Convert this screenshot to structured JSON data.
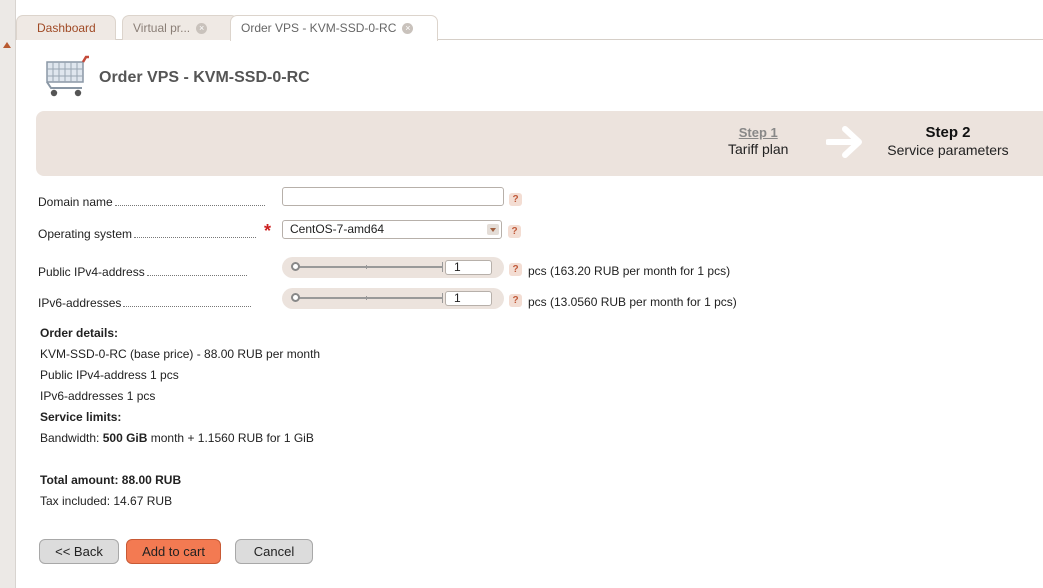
{
  "tabs": [
    {
      "label": "Dashboard"
    },
    {
      "label": "Virtual pr...",
      "closable": true
    },
    {
      "label": "Order VPS - KVM-SSD-0-RC",
      "closable": true,
      "active": true
    }
  ],
  "tab_separator": ">",
  "tab_close_glyph": "×",
  "page": {
    "title": "Order VPS - KVM-SSD-0-RC",
    "icon": "shopping-cart-icon"
  },
  "wizard": {
    "step1": {
      "label": "Step 1",
      "sub": "Tariff plan"
    },
    "step2": {
      "label": "Step 2",
      "sub": "Service parameters"
    }
  },
  "form": {
    "domain": {
      "label": "Domain name",
      "value": ""
    },
    "os": {
      "label": "Operating system",
      "required_mark": "*",
      "value": "CentOS-7-amd64"
    },
    "ipv4": {
      "label": "Public IPv4-address",
      "value": "1",
      "unit": "pcs (163.20 RUB per month for 1 pcs)",
      "slider_fraction": 0.0
    },
    "ipv6": {
      "label": "IPv6-addresses",
      "value": "1",
      "unit": "pcs (13.0560 RUB per month for 1 pcs)",
      "slider_fraction": 0.0
    },
    "help_glyph": "?"
  },
  "details": {
    "order_heading": "Order details:",
    "base": "KVM-SSD-0-RC (base price) - 88.00 RUB per month",
    "ipv4": "Public IPv4-address 1 pcs",
    "ipv6": "IPv6-addresses 1 pcs",
    "limits_heading": "Service limits:",
    "bandwidth_prefix": "Bandwidth: ",
    "bandwidth_value": "500 GiB",
    "bandwidth_suffix": " month + 1.1560 RUB for 1 GiB",
    "total": "Total amount: 88.00 RUB",
    "tax": "Tax included: 14.67 RUB"
  },
  "buttons": {
    "back": "<< Back",
    "add_to_cart": "Add to cart",
    "cancel": "Cancel"
  },
  "colors": {
    "accent": "#f37a52",
    "tab_text": "#a04a25",
    "wizard_bg": "#ece3dd",
    "required": "#cc2020"
  }
}
